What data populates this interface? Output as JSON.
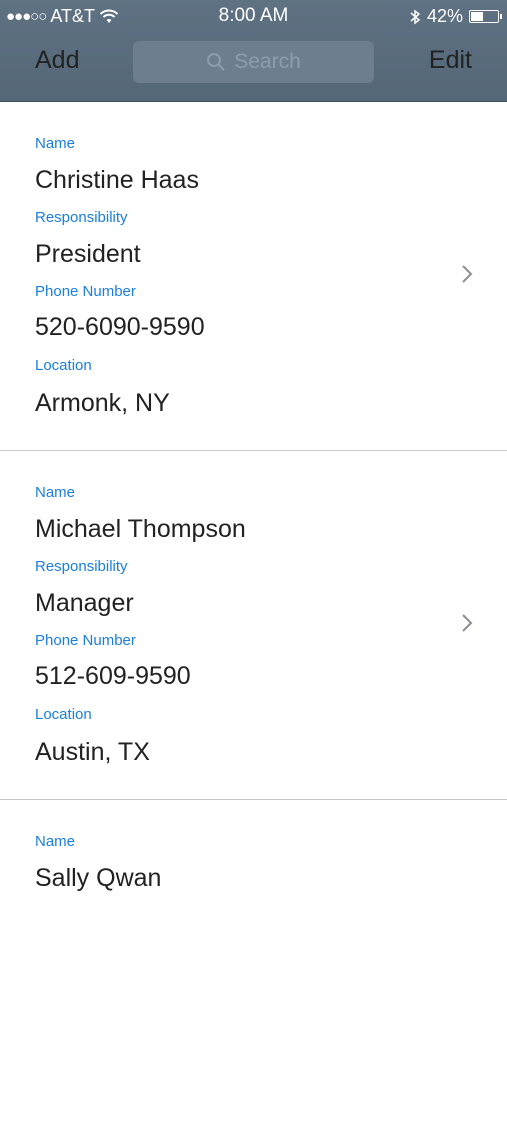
{
  "status_bar": {
    "signal": "●●●○○",
    "carrier": "AT&T",
    "time": "8:00 AM",
    "battery": "42%",
    "battery_level": 0.42
  },
  "nav": {
    "add_label": "Add",
    "search_placeholder": "Search",
    "edit_label": "Edit"
  },
  "contacts": [
    {
      "name_label": "Name",
      "name": "Christine Haas",
      "resp_label": "Responsibility",
      "responsibility": "President",
      "phone_label": "Phone Number",
      "phone": "520-6090-9590",
      "loc_label": "Location",
      "location": "Armonk, NY"
    },
    {
      "name_label": "Name",
      "name": "Michael Thompson",
      "resp_label": "Responsibility",
      "responsibility": "Manager",
      "phone_label": "Phone Number",
      "phone": "512-609-9590",
      "loc_label": "Location",
      "location": "Austin, TX"
    },
    {
      "name_label": "Name",
      "name": "Sally Qwan",
      "resp_label": "",
      "responsibility": "",
      "phone_label": "",
      "phone": "",
      "loc_label": "",
      "location": ""
    }
  ],
  "colors": {
    "nav_bg": "#5a6d7e",
    "label_blue": "#1a7fe0",
    "separator": "#c8c7cc"
  }
}
